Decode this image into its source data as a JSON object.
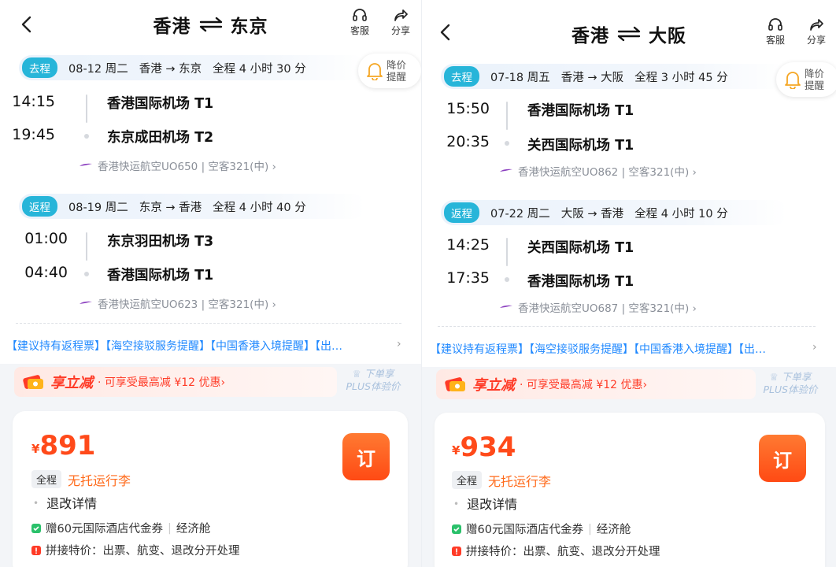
{
  "panels": [
    {
      "header": {
        "from": "香港",
        "to": "东京",
        "service_label": "客服",
        "share_label": "分享"
      },
      "alert": {
        "line1": "降价",
        "line2": "提醒"
      },
      "outbound": {
        "tag": "去程",
        "date": "08-12 周二",
        "route": "香港 → 东京",
        "duration": "全程 4 小时 30 分",
        "dep_time": "14:15",
        "dep_airport": "香港国际机场 T1",
        "arr_time": "19:45",
        "arr_airport": "东京成田机场 T2",
        "flight": "香港快运航空UO650 | 空客321(中) ›"
      },
      "return": {
        "tag": "返程",
        "date": "08-19 周二",
        "route": "东京 → 香港",
        "duration": "全程 4 小时 40 分",
        "dep_time": "01:00",
        "dep_airport": "东京羽田机场 T3",
        "arr_time": "04:40",
        "arr_airport": "香港国际机场 T1",
        "flight": "香港快运航空UO623 | 空客321(中) ›"
      },
      "notice": "【建议持有返程票】【海空接驳服务提醒】【中国香港入境提醒】【出…",
      "promo": {
        "big": "享立减",
        "small": "· 可享受最高减 ¥12 优惠›"
      },
      "plus": {
        "line1": "下单享",
        "line2": "PLUS体验价"
      },
      "offer": {
        "yen": "¥",
        "price": "891",
        "book": "订",
        "pill": "全程",
        "baggage": "无托运行李",
        "rules": "退改详情",
        "perk1": "赠60元国际酒店代金券",
        "perk1b": "经济舱",
        "perk2": "拼接特价：出票、航变、退改分开处理"
      }
    },
    {
      "header": {
        "from": "香港",
        "to": "大阪",
        "service_label": "客服",
        "share_label": "分享"
      },
      "alert": {
        "line1": "降价",
        "line2": "提醒"
      },
      "outbound": {
        "tag": "去程",
        "date": "07-18 周五",
        "route": "香港 → 大阪",
        "duration": "全程 3 小时 45 分",
        "dep_time": "15:50",
        "dep_airport": "香港国际机场 T1",
        "arr_time": "20:35",
        "arr_airport": "关西国际机场 T1",
        "flight": "香港快运航空UO862 | 空客321(中) ›"
      },
      "return": {
        "tag": "返程",
        "date": "07-22 周二",
        "route": "大阪 → 香港",
        "duration": "全程 4 小时 10 分",
        "dep_time": "14:25",
        "dep_airport": "关西国际机场 T1",
        "arr_time": "17:35",
        "arr_airport": "香港国际机场 T1",
        "flight": "香港快运航空UO687 | 空客321(中) ›"
      },
      "notice": "【建议持有返程票】【海空接驳服务提醒】【中国香港入境提醒】【出…",
      "promo": {
        "big": "享立减",
        "small": "· 可享受最高减 ¥12 优惠›"
      },
      "plus": {
        "line1": "下单享",
        "line2": "PLUS体验价"
      },
      "offer": {
        "yen": "¥",
        "price": "934",
        "book": "订",
        "pill": "全程",
        "baggage": "无托运行李",
        "rules": "退改详情",
        "perk1": "赠60元国际酒店代金券",
        "perk1b": "经济舱",
        "perk2": "拼接特价：出票、航变、退改分开处理"
      }
    }
  ],
  "colors": {
    "accent_blue": "#27b5d9",
    "link_blue": "#1f88ff",
    "price_orange": "#ff4a1a",
    "promo_red": "#ff3b27"
  },
  "icons": [
    "back-arrow-icon",
    "headset-icon",
    "share-icon",
    "swap-arrows-icon",
    "bell-icon",
    "airline-logo-icon",
    "coupon-icon",
    "plus-member-icon",
    "check-icon",
    "warning-icon"
  ]
}
